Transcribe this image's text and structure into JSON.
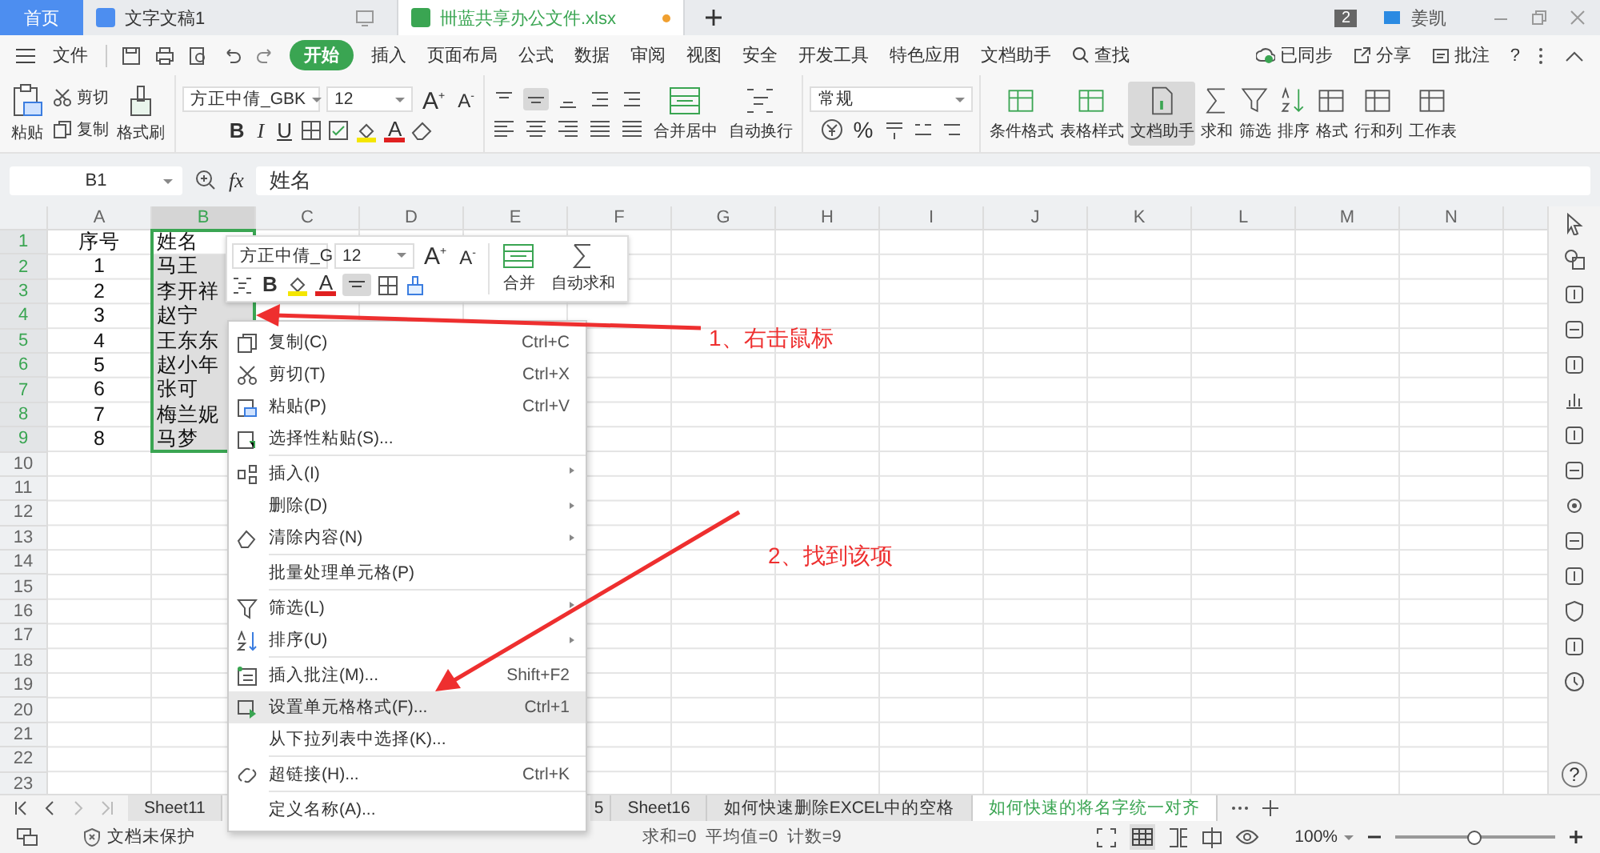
{
  "tabs": [
    {
      "label": "首页",
      "kind": "home",
      "selected": false
    },
    {
      "label": "文字文稿1",
      "kind": "doc",
      "selected": false
    },
    {
      "label": "卌蓝共享办公文件.xlsx",
      "kind": "sheet",
      "selected": true
    }
  ],
  "window": {
    "badge": "2",
    "user": "姜凯"
  },
  "menu": {
    "file": "文件",
    "items": [
      {
        "label": "开始",
        "selected": true
      },
      {
        "label": "插入",
        "selected": false
      },
      {
        "label": "页面布局",
        "selected": false
      },
      {
        "label": "公式",
        "selected": false
      },
      {
        "label": "数据",
        "selected": false
      },
      {
        "label": "审阅",
        "selected": false
      },
      {
        "label": "视图",
        "selected": false
      },
      {
        "label": "安全",
        "selected": false
      },
      {
        "label": "开发工具",
        "selected": false
      },
      {
        "label": "特色应用",
        "selected": false
      },
      {
        "label": "文档助手",
        "selected": false
      }
    ],
    "search": "查找",
    "sync": "已同步",
    "share": "分享",
    "comment": "批注",
    "help": "?"
  },
  "ribbon": {
    "paste": "粘贴",
    "cut": "剪切",
    "copy": "复制",
    "format_painter": "格式刷",
    "font": "方正中倩_GBK",
    "size": "12",
    "grow": "A$^{+}$",
    "shrink": "A$^{-}$",
    "bold": "B",
    "italic": "I",
    "underline": "U",
    "font_color": "A",
    "merge": "合并居中",
    "wrap": "自动换行",
    "number_format": "常规",
    "percent": "%",
    "tools": [
      {
        "label": "条件格式",
        "selected": false
      },
      {
        "label": "表格样式",
        "selected": false
      },
      {
        "label": "文档助手",
        "selected": true
      },
      {
        "label": "求和",
        "selected": false
      },
      {
        "label": "筛选",
        "selected": false
      },
      {
        "label": "排序",
        "selected": false
      },
      {
        "label": "格式",
        "selected": false
      },
      {
        "label": "行和列",
        "selected": false
      },
      {
        "label": "工作表",
        "selected": false
      }
    ]
  },
  "formula_bar": {
    "cell": "B1",
    "fx": "fx",
    "value": "姓名"
  },
  "columns": [
    {
      "label": "A",
      "selected": false
    },
    {
      "label": "B",
      "selected": true
    },
    {
      "label": "C",
      "selected": false
    },
    {
      "label": "D",
      "selected": false
    },
    {
      "label": "E",
      "selected": false
    },
    {
      "label": "F",
      "selected": false
    },
    {
      "label": "G",
      "selected": false
    },
    {
      "label": "H",
      "selected": false
    },
    {
      "label": "I",
      "selected": false
    },
    {
      "label": "J",
      "selected": false
    },
    {
      "label": "K",
      "selected": false
    },
    {
      "label": "L",
      "selected": false
    },
    {
      "label": "M",
      "selected": false
    },
    {
      "label": "N",
      "selected": false
    }
  ],
  "rows": [
    {
      "number": "1",
      "selected": true,
      "cells": [
        "序号",
        "姓名"
      ]
    },
    {
      "number": "2",
      "selected": true,
      "cells": [
        "1",
        "马王"
      ]
    },
    {
      "number": "3",
      "selected": true,
      "cells": [
        "2",
        "李开祥"
      ]
    },
    {
      "number": "4",
      "selected": true,
      "cells": [
        "3",
        "赵宁"
      ]
    },
    {
      "number": "5",
      "selected": true,
      "cells": [
        "4",
        "王东东"
      ]
    },
    {
      "number": "6",
      "selected": true,
      "cells": [
        "5",
        "赵小年"
      ]
    },
    {
      "number": "7",
      "selected": true,
      "cells": [
        "6",
        "张可"
      ]
    },
    {
      "number": "8",
      "selected": true,
      "cells": [
        "7",
        "梅兰妮"
      ]
    },
    {
      "number": "9",
      "selected": true,
      "cells": [
        "8",
        "马梦"
      ]
    },
    {
      "number": "10",
      "selected": false,
      "cells": []
    },
    {
      "number": "11",
      "selected": false,
      "cells": []
    },
    {
      "number": "12",
      "selected": false,
      "cells": []
    },
    {
      "number": "13",
      "selected": false,
      "cells": []
    },
    {
      "number": "14",
      "selected": false,
      "cells": []
    },
    {
      "number": "15",
      "selected": false,
      "cells": []
    },
    {
      "number": "16",
      "selected": false,
      "cells": []
    },
    {
      "number": "17",
      "selected": false,
      "cells": []
    },
    {
      "number": "18",
      "selected": false,
      "cells": []
    },
    {
      "number": "19",
      "selected": false,
      "cells": []
    },
    {
      "number": "20",
      "selected": false,
      "cells": []
    },
    {
      "number": "21",
      "selected": false,
      "cells": []
    },
    {
      "number": "22",
      "selected": false,
      "cells": []
    },
    {
      "number": "23",
      "selected": false,
      "cells": []
    }
  ],
  "mini_toolbar": {
    "font": "方正中倩_G",
    "size": "12",
    "grow": "A$^{+}$",
    "shrink": "A$^{-}$",
    "bold": "B",
    "font_color": "A",
    "merge": "合并",
    "autosum": "自动求和"
  },
  "context_menu": [
    {
      "label": "复制(C)",
      "shortcut": "Ctrl+C",
      "submenu": false,
      "separator_before": false,
      "selected": false
    },
    {
      "label": "剪切(T)",
      "shortcut": "Ctrl+X",
      "submenu": false,
      "separator_before": false,
      "selected": false
    },
    {
      "label": "粘贴(P)",
      "shortcut": "Ctrl+V",
      "submenu": false,
      "separator_before": false,
      "selected": false
    },
    {
      "label": "选择性粘贴(S)...",
      "submenu": false,
      "separator_before": false,
      "selected": false
    },
    {
      "label": "插入(I)",
      "submenu": true,
      "separator_before": true,
      "selected": false
    },
    {
      "label": "删除(D)",
      "submenu": true,
      "separator_before": false,
      "selected": false
    },
    {
      "label": "清除内容(N)",
      "submenu": true,
      "separator_before": false,
      "selected": false
    },
    {
      "label": "批量处理单元格(P)",
      "submenu": false,
      "separator_before": true,
      "selected": false
    },
    {
      "label": "筛选(L)",
      "submenu": true,
      "separator_before": true,
      "selected": false
    },
    {
      "label": "排序(U)",
      "submenu": true,
      "separator_before": false,
      "selected": false
    },
    {
      "label": "插入批注(M)...",
      "shortcut": "Shift+F2",
      "submenu": false,
      "separator_before": true,
      "selected": false
    },
    {
      "label": "设置单元格格式(F)...",
      "shortcut": "Ctrl+1",
      "submenu": false,
      "separator_before": false,
      "selected": true
    },
    {
      "label": "从下拉列表中选择(K)...",
      "submenu": false,
      "separator_before": false,
      "selected": false
    },
    {
      "label": "超链接(H)...",
      "shortcut": "Ctrl+K",
      "submenu": false,
      "separator_before": true,
      "selected": false
    },
    {
      "label": "定义名称(A)...",
      "submenu": false,
      "separator_before": true,
      "selected": false
    }
  ],
  "sheet_tabs": [
    {
      "label": "Sheet11",
      "selected": false
    },
    {
      "label": "5",
      "selected": false
    },
    {
      "label": "Sheet16",
      "selected": false
    },
    {
      "label": "如何快速删除EXCEL中的空格",
      "selected": false
    },
    {
      "label": "如何快速的将名字统一对齐",
      "selected": true
    }
  ],
  "status_bar": {
    "protection": "文档未保护",
    "stats": "求和=0  平均值=0  计数=9",
    "zoom": "100%",
    "zoom_level": {
      "level": 0.5
    }
  },
  "annotations": [
    {
      "text": "1、右击鼠标"
    },
    {
      "text": "2、找到该项"
    }
  ]
}
